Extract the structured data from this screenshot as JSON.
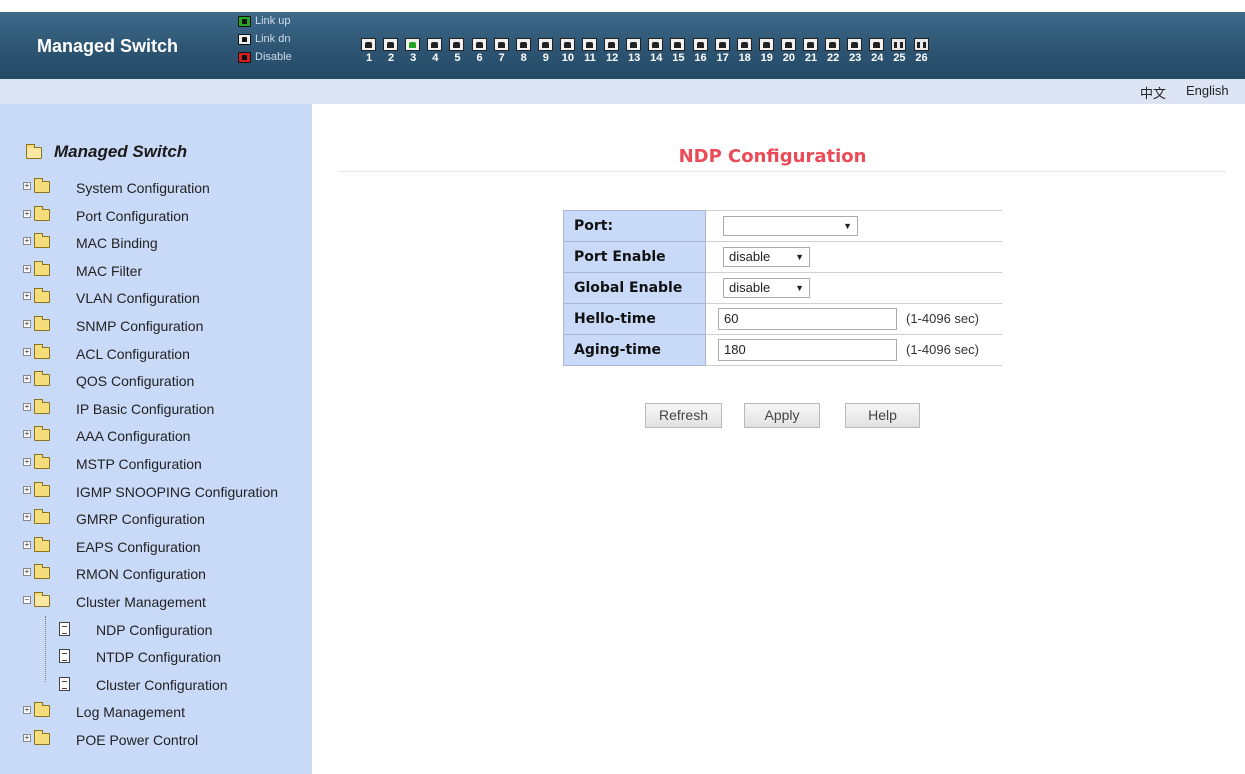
{
  "header": {
    "brand": "Managed Switch",
    "legend": [
      {
        "label": "Link up",
        "color": "#25a325"
      },
      {
        "label": "Link dn",
        "color": "#222222"
      },
      {
        "label": "Disable",
        "color": "#d62020"
      }
    ],
    "ports": [
      {
        "num": "1",
        "state": "dn"
      },
      {
        "num": "2",
        "state": "dn"
      },
      {
        "num": "3",
        "state": "up"
      },
      {
        "num": "4",
        "state": "dn"
      },
      {
        "num": "5",
        "state": "dn"
      },
      {
        "num": "6",
        "state": "dn"
      },
      {
        "num": "7",
        "state": "dn"
      },
      {
        "num": "8",
        "state": "dn"
      },
      {
        "num": "9",
        "state": "dn"
      },
      {
        "num": "10",
        "state": "dn"
      },
      {
        "num": "11",
        "state": "dn"
      },
      {
        "num": "12",
        "state": "dn"
      },
      {
        "num": "13",
        "state": "dn"
      },
      {
        "num": "14",
        "state": "dn"
      },
      {
        "num": "15",
        "state": "dn"
      },
      {
        "num": "16",
        "state": "dn"
      },
      {
        "num": "17",
        "state": "dn"
      },
      {
        "num": "18",
        "state": "dn"
      },
      {
        "num": "19",
        "state": "dn"
      },
      {
        "num": "20",
        "state": "dn"
      },
      {
        "num": "21",
        "state": "dn"
      },
      {
        "num": "22",
        "state": "dn"
      },
      {
        "num": "23",
        "state": "dn"
      },
      {
        "num": "24",
        "state": "dn"
      },
      {
        "num": "25",
        "state": "fiber"
      },
      {
        "num": "26",
        "state": "fiber"
      }
    ]
  },
  "lang": {
    "zh": "中文",
    "en": "English"
  },
  "sidebar": {
    "root": "Managed Switch",
    "items": [
      "System Configuration",
      "Port Configuration",
      "MAC Binding",
      "MAC Filter",
      "VLAN Configuration",
      "SNMP Configuration",
      "ACL Configuration",
      "QOS Configuration",
      "IP Basic Configuration",
      "AAA Configuration",
      "MSTP Configuration",
      "IGMP SNOOPING Configuration",
      "GMRP Configuration",
      "EAPS Configuration",
      "RMON Configuration",
      "Cluster Management"
    ],
    "cluster_children": [
      "NDP Configuration",
      "NTDP Configuration",
      "Cluster Configuration"
    ],
    "items_after": [
      "Log Management",
      "POE Power Control"
    ]
  },
  "main": {
    "title": "NDP Configuration",
    "form": {
      "port_label": "Port:",
      "port_value": "",
      "port_enable_label": "Port Enable",
      "port_enable_value": "disable",
      "global_enable_label": "Global Enable",
      "global_enable_value": "disable",
      "hello_label": "Hello-time",
      "hello_value": "60",
      "hello_range": "(1-4096 sec)",
      "aging_label": "Aging-time",
      "aging_value": "180",
      "aging_range": "(1-4096 sec)"
    },
    "buttons": {
      "refresh": "Refresh",
      "apply": "Apply",
      "help": "Help"
    }
  }
}
